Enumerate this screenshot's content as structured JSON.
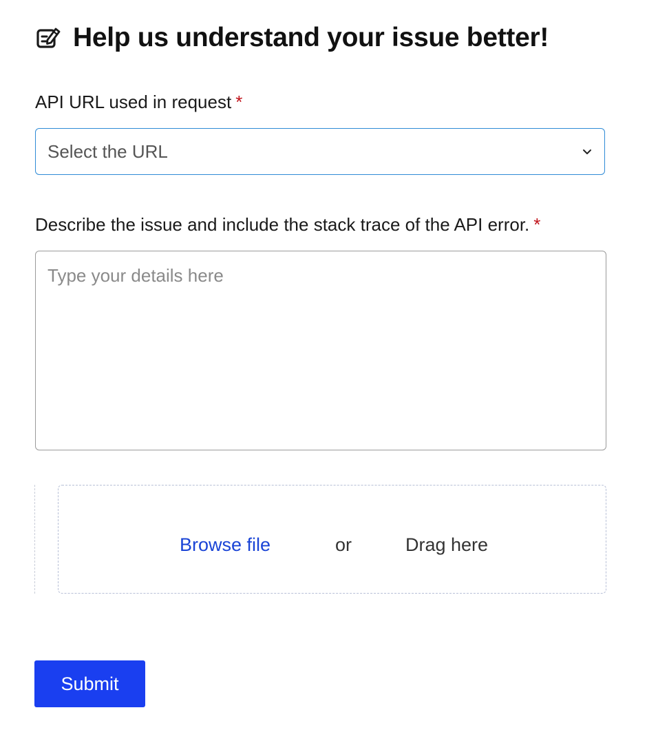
{
  "header": {
    "icon": "edit-note-icon",
    "title": "Help us understand your issue better!"
  },
  "fields": {
    "url": {
      "label": "API URL used in request",
      "required_mark": "*",
      "value": "Select the URL",
      "chevron_icon": "chevron-down-icon"
    },
    "description": {
      "label": "Describe the issue and include the stack trace of the API error.",
      "required_mark": "*",
      "placeholder": "Type your details here"
    }
  },
  "dropzone": {
    "browse_label": "Browse file",
    "or_label": "or",
    "drag_label": "Drag here"
  },
  "submit_label": "Submit",
  "colors": {
    "accent": "#1a3ff0",
    "link": "#1a44d6",
    "required": "#c0131b",
    "focus_border": "#2e8ad6"
  }
}
